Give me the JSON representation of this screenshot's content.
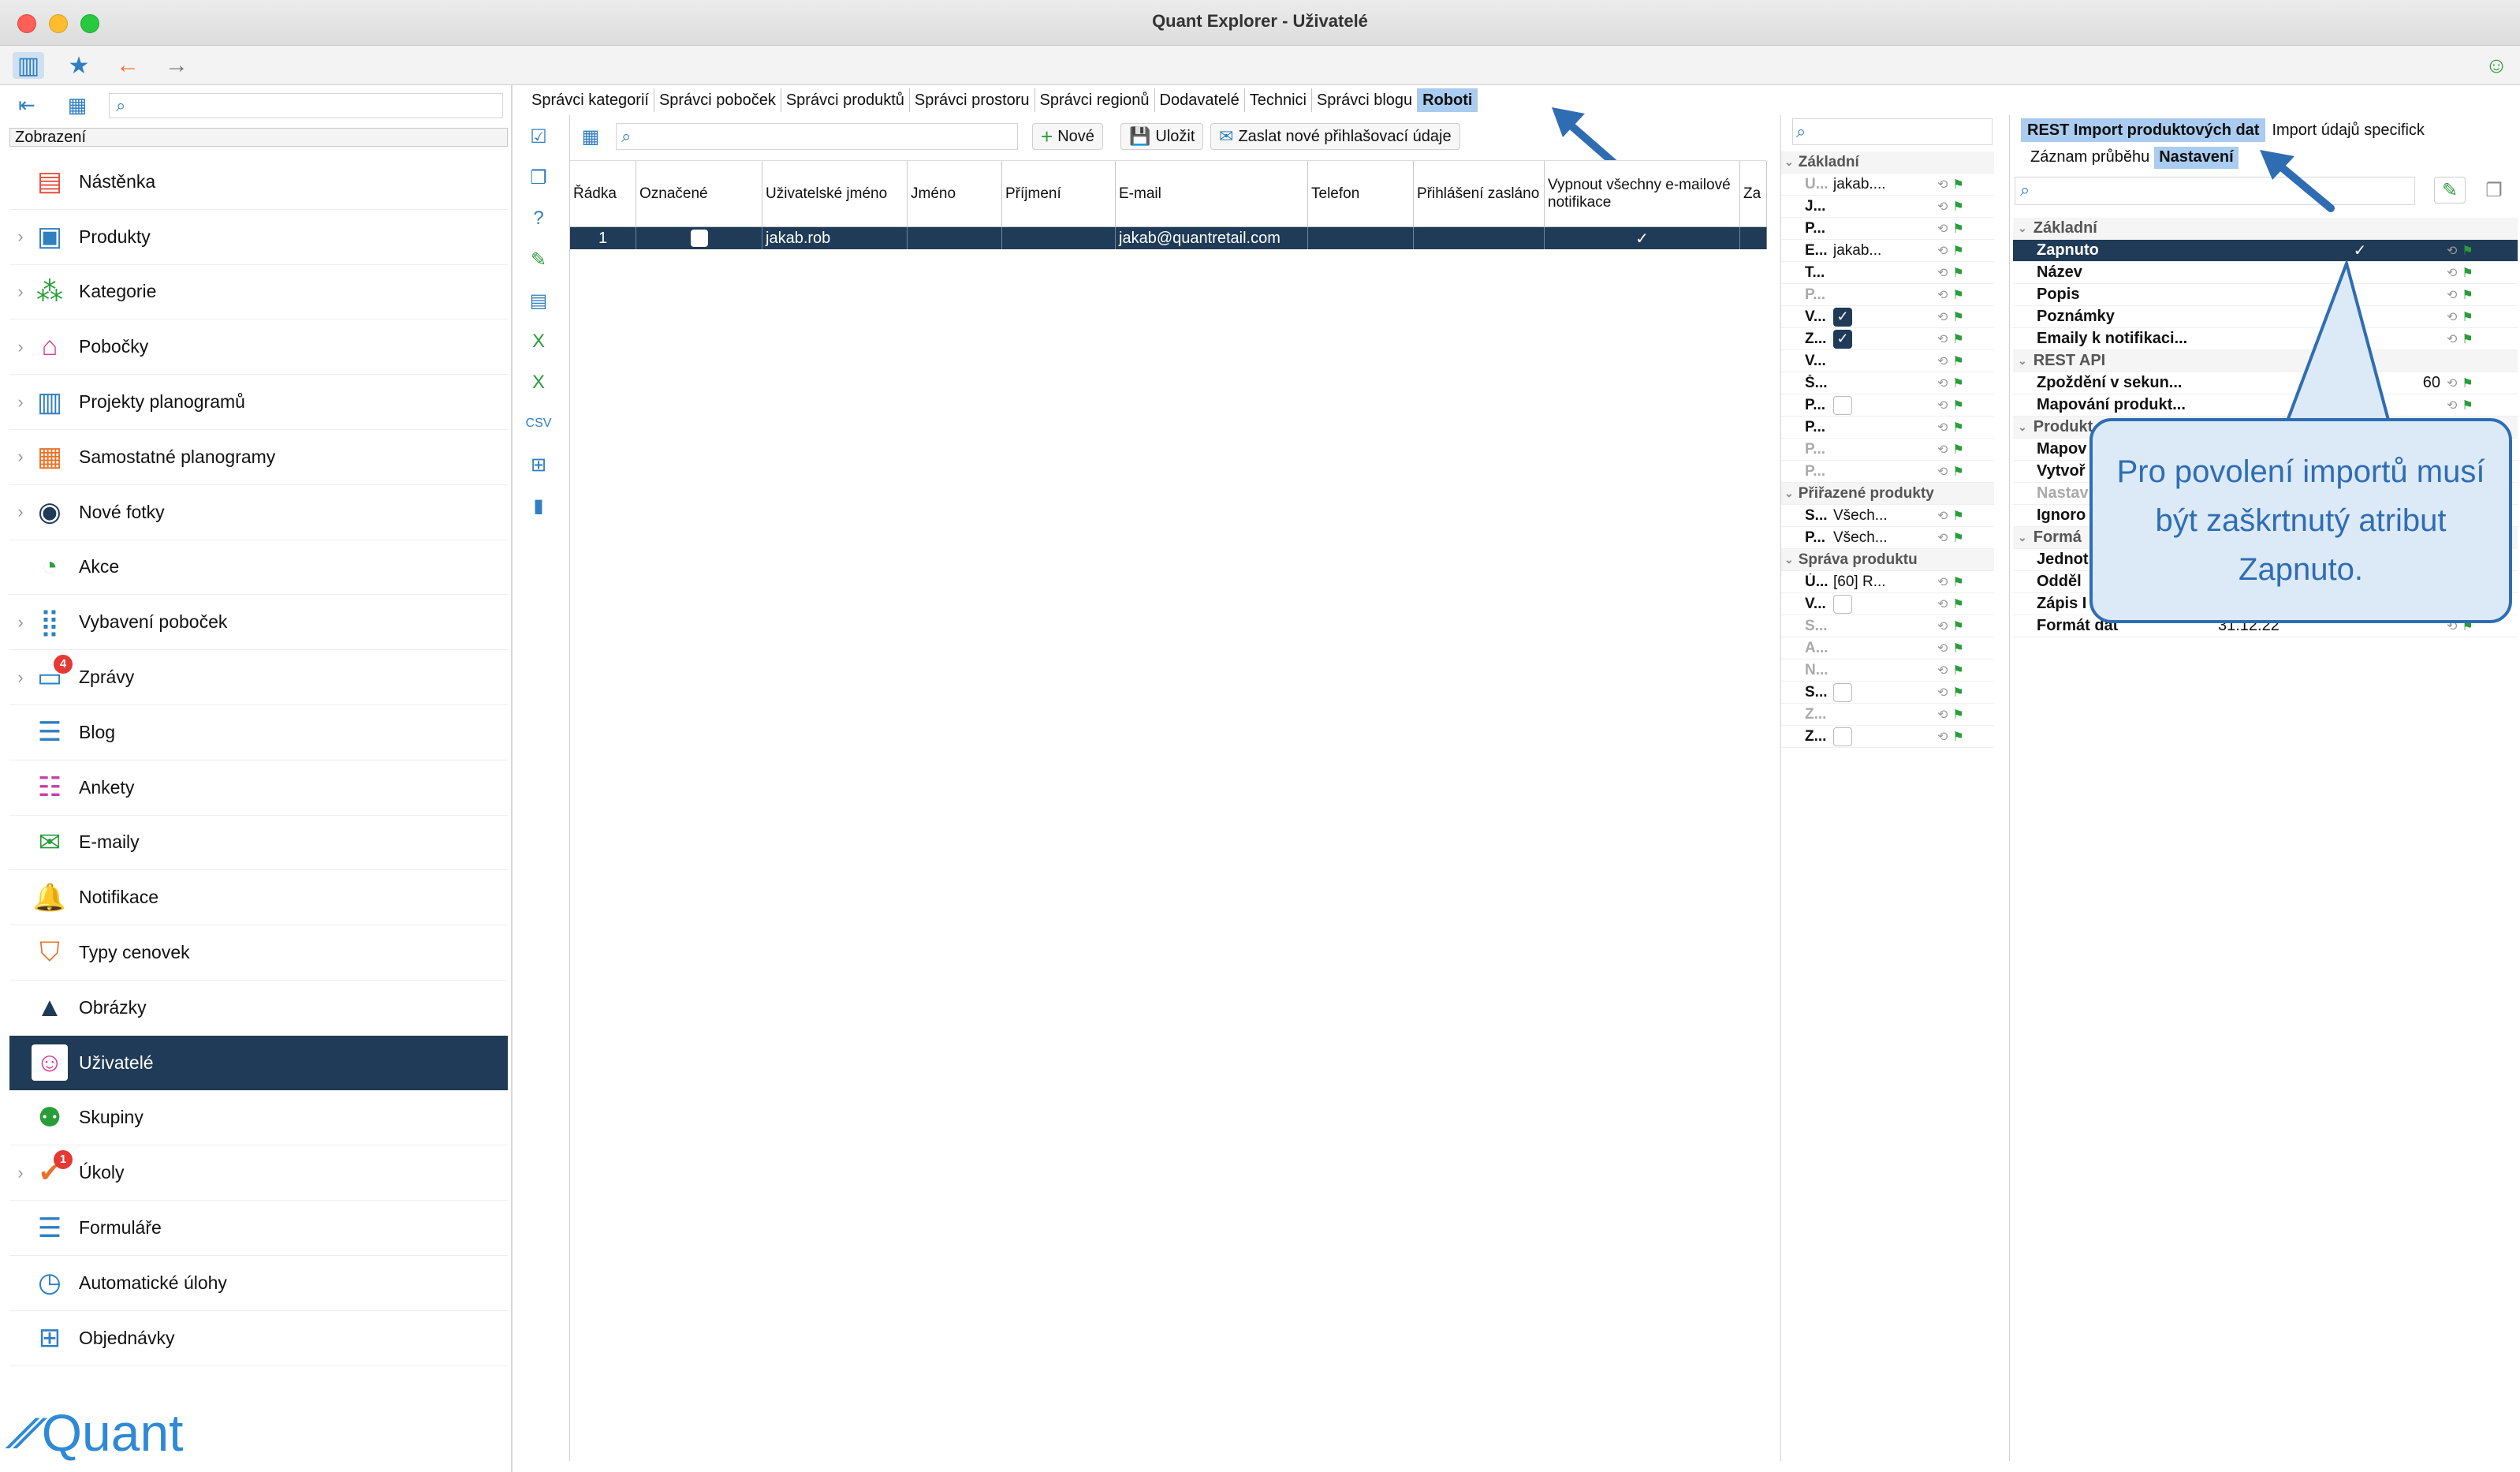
{
  "window": {
    "title": "Quant Explorer - Uživatelé"
  },
  "sidebar": {
    "header": "Zobrazení",
    "items": [
      {
        "label": "Nástěnka",
        "icon": "dashboard-icon",
        "chevron": false
      },
      {
        "label": "Produkty",
        "icon": "product-icon",
        "chevron": true
      },
      {
        "label": "Kategorie",
        "icon": "category-icon",
        "chevron": true
      },
      {
        "label": "Pobočky",
        "icon": "store-icon",
        "chevron": true
      },
      {
        "label": "Projekty planogramů",
        "icon": "planogram-project-icon",
        "chevron": true
      },
      {
        "label": "Samostatné planogramy",
        "icon": "planogram-icon",
        "chevron": true
      },
      {
        "label": "Nové fotky",
        "icon": "camera-icon",
        "chevron": true
      },
      {
        "label": "Akce",
        "icon": "promo-icon",
        "chevron": false
      },
      {
        "label": "Vybavení poboček",
        "icon": "equipment-icon",
        "chevron": true
      },
      {
        "label": "Zprávy",
        "icon": "message-icon",
        "chevron": true,
        "badge": "4"
      },
      {
        "label": "Blog",
        "icon": "blog-icon",
        "chevron": false
      },
      {
        "label": "Ankety",
        "icon": "survey-icon",
        "chevron": false
      },
      {
        "label": "E-maily",
        "icon": "email-icon",
        "chevron": false
      },
      {
        "label": "Notifikace",
        "icon": "notification-icon",
        "chevron": false
      },
      {
        "label": "Typy cenovek",
        "icon": "price-tag-icon",
        "chevron": false
      },
      {
        "label": "Obrázky",
        "icon": "image-icon",
        "chevron": false
      },
      {
        "label": "Uživatelé",
        "icon": "user-icon",
        "chevron": false,
        "active": true
      },
      {
        "label": "Skupiny",
        "icon": "group-icon",
        "chevron": false
      },
      {
        "label": "Úkoly",
        "icon": "task-icon",
        "chevron": true,
        "badge": "1"
      },
      {
        "label": "Formuláře",
        "icon": "form-icon",
        "chevron": false
      },
      {
        "label": "Automatické úlohy",
        "icon": "auto-task-icon",
        "chevron": false
      },
      {
        "label": "Objednávky",
        "icon": "order-icon",
        "chevron": false
      }
    ],
    "logo_text": "Quant"
  },
  "tabs": [
    "Správci kategorií",
    "Správci poboček",
    "Správci produktů",
    "Správci prostoru",
    "Správci regionů",
    "Dodavatelé",
    "Technici",
    "Správci blogu",
    "Roboti"
  ],
  "grid": {
    "buttons": {
      "new": "Nové",
      "save": "Uložit",
      "send": "Zaslat nové přihlašovací údaje"
    },
    "columns": [
      "Řádka",
      "Označené",
      "Uživatelské jméno",
      "Jméno",
      "Příjmení",
      "E-mail",
      "Telefon",
      "Přihlášení zasláno",
      "Vypnout všechny e-mailové notifikace",
      "Za"
    ],
    "rows": [
      {
        "row": "1",
        "username": "jakab.rob",
        "first": "",
        "last": "",
        "email": "jakab@quantretail.com",
        "phone": "",
        "sent": "",
        "notif_off": "✓"
      }
    ]
  },
  "props": {
    "groups": [
      {
        "title": "Základní",
        "rows": [
          {
            "label": "U...",
            "value": "jakab....",
            "dim": true
          },
          {
            "label": "J...",
            "value": ""
          },
          {
            "label": "P...",
            "value": ""
          },
          {
            "label": "E...",
            "value": "jakab..."
          },
          {
            "label": "T...",
            "value": ""
          },
          {
            "label": "P...",
            "value": "",
            "dim": true
          },
          {
            "label": "V...",
            "value": "",
            "check": "on"
          },
          {
            "label": "Z...",
            "value": "",
            "check": "on"
          },
          {
            "label": "V...",
            "value": ""
          },
          {
            "label": "Š...",
            "value": ""
          },
          {
            "label": "P...",
            "value": "",
            "check": "off"
          },
          {
            "label": "P...",
            "value": ""
          },
          {
            "label": "P...",
            "value": "",
            "dim": true
          },
          {
            "label": "P...",
            "value": "",
            "dim": true
          }
        ]
      },
      {
        "title": "Přiřazené produkty",
        "rows": [
          {
            "label": "S...",
            "value": "Všech..."
          },
          {
            "label": "P...",
            "value": "Všech..."
          }
        ]
      },
      {
        "title": "Správa produktu",
        "rows": [
          {
            "label": "Ú...",
            "value": "[60] R..."
          },
          {
            "label": "V...",
            "value": "",
            "check": "off"
          },
          {
            "label": "S...",
            "value": "",
            "dim": true
          },
          {
            "label": "A...",
            "value": "",
            "dim": true
          },
          {
            "label": "N...",
            "value": "",
            "dim": true
          },
          {
            "label": "S...",
            "value": "",
            "check": "off"
          },
          {
            "label": "Z...",
            "value": "",
            "dim": true
          },
          {
            "label": "Z...",
            "value": "",
            "check": "off"
          }
        ]
      }
    ]
  },
  "right": {
    "tabs": [
      "REST Import produktových dat",
      "Import údajů specifick"
    ],
    "subtabs": [
      "Záznam průběhu",
      "Nastavení"
    ],
    "groups": [
      {
        "title": "Základní",
        "rows": [
          {
            "label": "Zapnuto",
            "value": "✓",
            "selected": true
          },
          {
            "label": "Název",
            "value": ""
          },
          {
            "label": "Popis",
            "value": ""
          },
          {
            "label": "Poznámky",
            "value": ""
          },
          {
            "label": "Emaily k notifikaci...",
            "value": ""
          }
        ]
      },
      {
        "title": "REST API",
        "rows": [
          {
            "label": "Zpoždění v sekun...",
            "value": "60"
          },
          {
            "label": "Mapování produkt...",
            "value": ""
          }
        ]
      },
      {
        "title": "Produkt",
        "rows": [
          {
            "label": "Mapov",
            "value": ""
          },
          {
            "label": "Vytvoř",
            "value": ""
          },
          {
            "label": "Nastav",
            "value": "",
            "dim": true
          },
          {
            "label": "Ignoro",
            "value": ""
          }
        ]
      },
      {
        "title": "Formá",
        "rows": [
          {
            "label": "Jednot",
            "value": ""
          },
          {
            "label": "Odděl",
            "value": ""
          },
          {
            "label": "Zápis I",
            "value": ""
          },
          {
            "label": "Formát dat",
            "value": "31.12.22"
          }
        ]
      }
    ]
  },
  "callout": {
    "text": "Pro povolení importů musí být zaškrtnutý atribut Zapnuto."
  },
  "colors": {
    "accent": "#2f6db3",
    "selection": "#1f3b57",
    "tab_selected": "#a9ccf0"
  }
}
